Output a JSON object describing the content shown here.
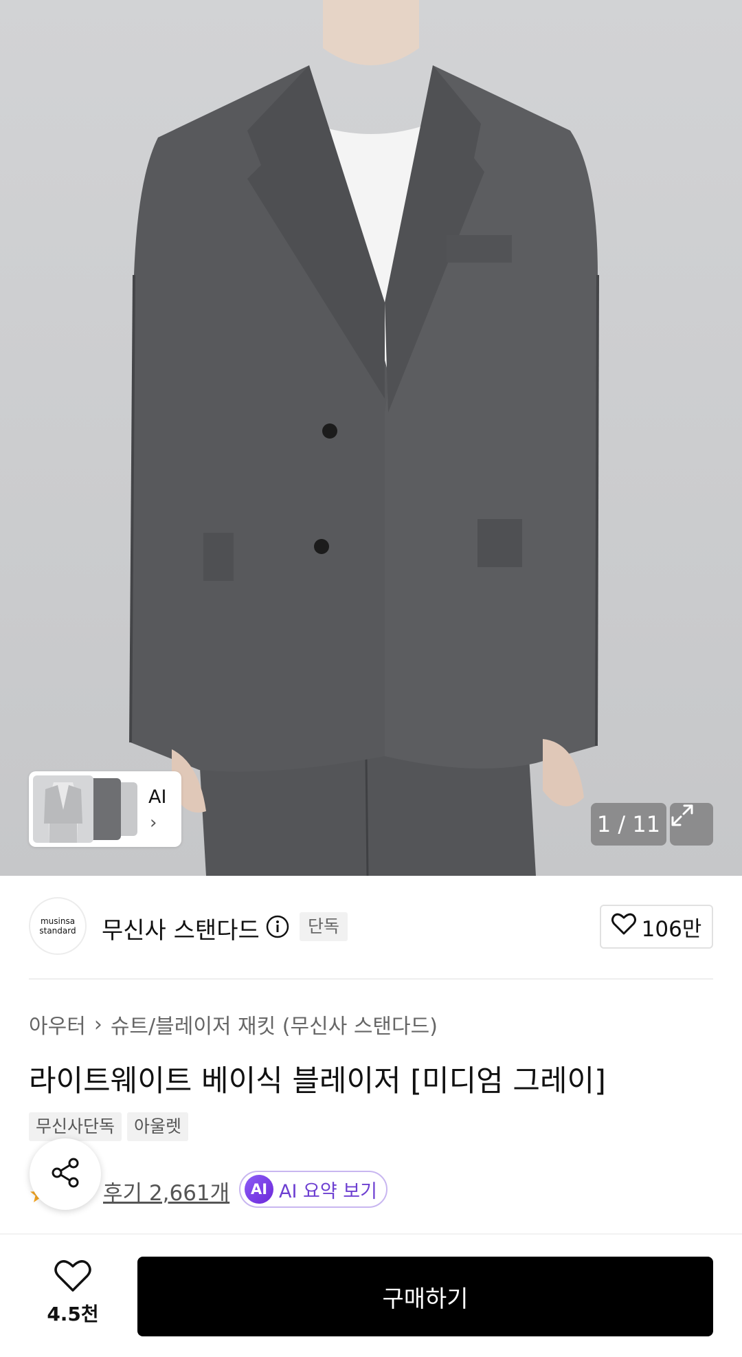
{
  "hero": {
    "thumb_label": "AI",
    "counter": "1 / 11"
  },
  "brand": {
    "logo_line1": "musinsa",
    "logo_line2": "standard",
    "name": "무신사 스탠다드",
    "badge": "단독",
    "likes": "106만"
  },
  "product": {
    "breadcrumb": [
      "아우터",
      "슈트/블레이저 재킷 (무신사 스탠다드)"
    ],
    "title": "라이트웨이트 베이식 블레이저 [미디엄 그레이]",
    "tags": [
      "무신사단독",
      "아울렛"
    ],
    "review_text": "후기 2,661개",
    "ai_summary_badge": "AI",
    "ai_summary_label": "AI 요약 보기"
  },
  "bottom": {
    "wish_count": "4.5천",
    "buy_label": "구매하기"
  },
  "colors": {
    "accent_purple": "#6d3fd1",
    "buy_button": "#000000",
    "star": "#f5a623"
  }
}
